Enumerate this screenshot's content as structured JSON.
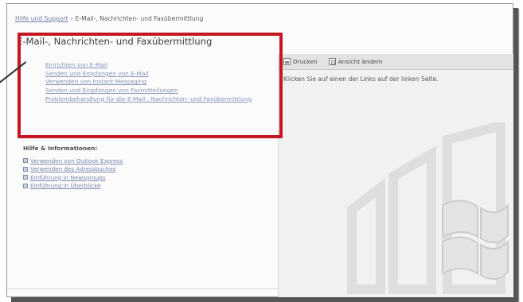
{
  "breadcrumb": {
    "root": "Hilfe und Support",
    "current": "E-Mail-, Nachrichten- und Faxübermittlung"
  },
  "page_title": "E-Mail-, Nachrichten- und Faxübermittlung",
  "tasks": [
    "Einrichten von E-Mail",
    "Senden und Empfangen von E-Mail",
    "Verwenden von Instant Messaging",
    "Senden und Empfangen von Faxmitteilungen",
    "Problembehandlung für die E-Mail-, Nachrichten- und Faxübermittlung"
  ],
  "info_heading": "Hilfe & Informationen:",
  "info_links": [
    "Verwenden von Outlook Express",
    "Verwenden des Adressbuches",
    "Einführung in Newsgroups",
    "Einführung in Überblicke"
  ],
  "toolbar": {
    "print_label": "Drucken",
    "view_label": "Ansicht ändern"
  },
  "panel_text": "Klicken Sie auf einen der Links auf der linken Seite.",
  "colors": {
    "highlight": "#c51622",
    "link": "#8994b8",
    "panel_bg": "#f1f1f1"
  }
}
